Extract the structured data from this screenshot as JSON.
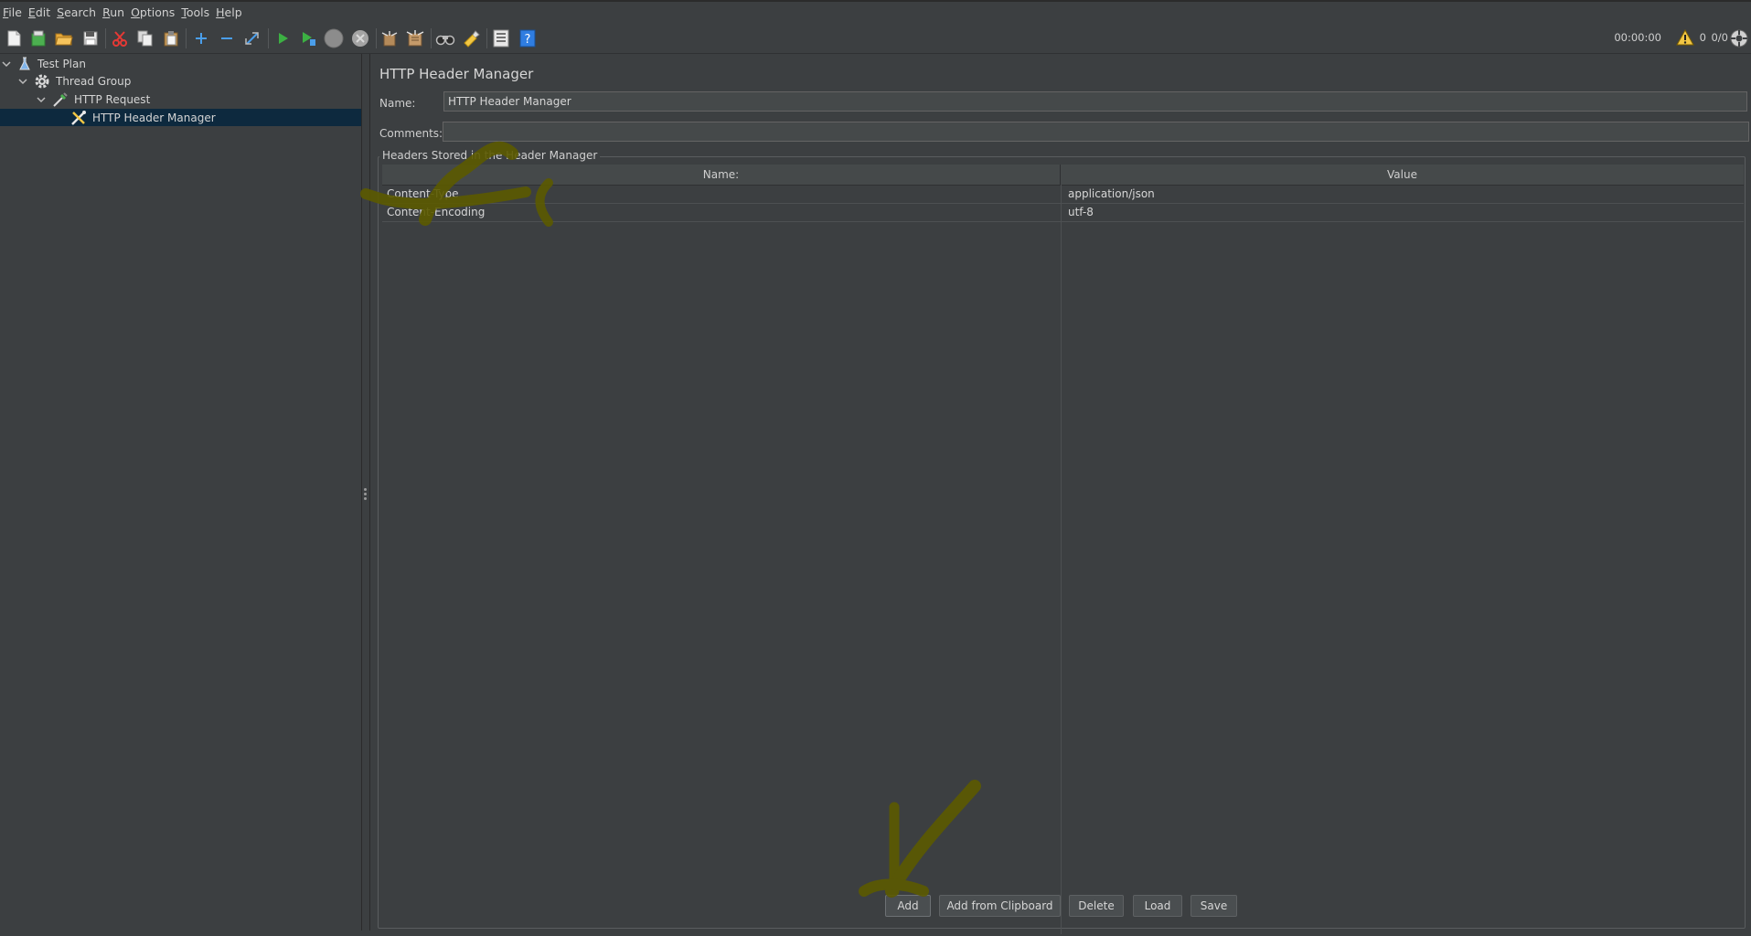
{
  "menubar": {
    "items": [
      {
        "mnemonic": "F",
        "rest": "ile"
      },
      {
        "mnemonic": "E",
        "rest": "dit"
      },
      {
        "mnemonic": "S",
        "rest": "earch"
      },
      {
        "mnemonic": "R",
        "rest": "un"
      },
      {
        "mnemonic": "O",
        "rest": "ptions"
      },
      {
        "mnemonic": "T",
        "rest": "ools"
      },
      {
        "mnemonic": "H",
        "rest": "elp"
      }
    ]
  },
  "toolbar": {
    "timer": "00:00:00",
    "error_count": "0",
    "threads": "0/0",
    "icons": [
      "new-icon",
      "templates-icon",
      "open-icon",
      "save-icon",
      "cut-icon",
      "copy-icon",
      "paste-icon",
      "expand-icon",
      "collapse-icon",
      "toggle-icon",
      "start-icon",
      "start-no-pauses-icon",
      "stop-icon",
      "shutdown-icon",
      "clear-icon",
      "clear-all-icon",
      "search-icon",
      "reset-search-icon",
      "function-helper-icon",
      "help-icon"
    ],
    "warning_color": "#f2c744",
    "accent_green": "#3cb043"
  },
  "tree": {
    "items": [
      {
        "label": "Test Plan",
        "icon": "flask-icon"
      },
      {
        "label": "Thread Group",
        "icon": "gear-icon"
      },
      {
        "label": "HTTP Request",
        "icon": "pipette-icon"
      },
      {
        "label": "HTTP Header Manager",
        "icon": "tools-icon"
      }
    ],
    "selected_color": "#0d293e"
  },
  "main": {
    "title": "HTTP Header Manager",
    "name_label": "Name:",
    "name_value": "HTTP Header Manager",
    "comments_label": "Comments:",
    "comments_value": "",
    "group_title": "Headers Stored in the Header Manager",
    "columns": [
      "Name:",
      "Value"
    ],
    "rows": [
      {
        "name": "Content-Type",
        "value": "application/json"
      },
      {
        "name": "Content-Encoding",
        "value": "utf-8"
      }
    ],
    "buttons": {
      "add": "Add",
      "add_clipboard": "Add from Clipboard",
      "delete": "Delete",
      "load": "Load",
      "save": "Save"
    }
  },
  "annotation_color": "#5c5a00"
}
